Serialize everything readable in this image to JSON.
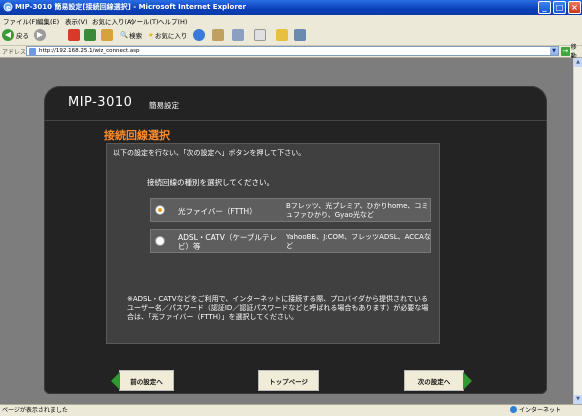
{
  "window": {
    "title": "MIP-3010 簡易設定[接続回線選択] - Microsoft Internet Explorer",
    "min": "_",
    "max": "□",
    "close": "×"
  },
  "menu": [
    "ファイル(F)",
    "編集(E)",
    "表示(V)",
    "お気に入り(A)",
    "ツール(T)",
    "ヘルプ(H)"
  ],
  "toolbar": {
    "back": "戻る",
    "search": "検索",
    "favorites": "お気に入り"
  },
  "address": {
    "label": "アドレス(D)",
    "url": "http://192.168.25.1/wiz_connect.asp",
    "go": "移動"
  },
  "page": {
    "model": "MIP-3010",
    "subtitle": "簡易設定",
    "title": "接続回線選択",
    "instruction": "以下の設定を行ない、「次の設定へ」ボタンを押して下さい。",
    "question": "接続回線の種別を選択してください。",
    "options": [
      {
        "name": "光ファイバー（FTTH）",
        "desc": "Bフレッツ、光プレミア、ひかりhome、コミュファひかり、Gyao光など",
        "checked": true
      },
      {
        "name": "ADSL・CATV（ケーブルテレビ）等",
        "desc": "YahooBB、J:COM、フレッツADSL、ACCAなど",
        "checked": false
      }
    ],
    "note": "※ADSL・CATVなどをご利用で、インターネットに接続する際、プロバイダから提供されているユーザー名／パスワード（認証ID／認証パスワードなどと呼ばれる場合もあります）が必要な場合は、「光ファイバー（FTTH）」を選択してください。",
    "buttons": {
      "prev": "前の設定へ",
      "top": "トップページ",
      "next": "次の設定へ"
    }
  },
  "status": {
    "left": "ページが表示されました",
    "zone": "インターネット"
  },
  "colors": {
    "title_accent": "#ff8a28",
    "nav_arrow": "#2f9a2f",
    "radio_selected": "#e8a020"
  }
}
